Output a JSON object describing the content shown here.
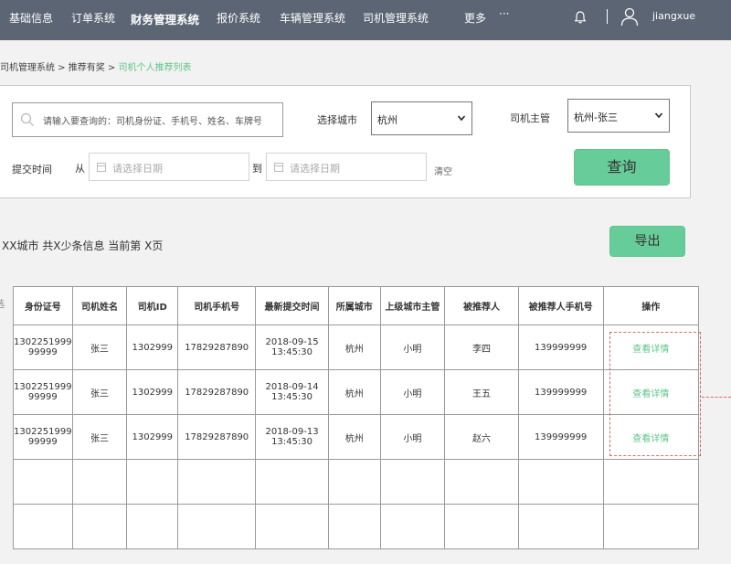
{
  "nav": {
    "items": [
      "基础信息",
      "订单系统",
      "财务管理系统",
      "报价系统",
      "车辆管理系统",
      "司机管理系统",
      "更多"
    ],
    "more_dots": "···",
    "username": "jiangxue"
  },
  "breadcrumb": {
    "part1": "司机管理系统",
    "sep1": " > ",
    "part2": "推荐有奖",
    "sep2": " > ",
    "current": "司机个人推荐列表"
  },
  "search": {
    "placeholder": "请输入要查询的：司机身份证、手机号、姓名、车牌号",
    "city_label": "选择城市",
    "city_value": "杭州",
    "manager_label": "司机主管",
    "manager_value": "杭州-张三",
    "time_label": "提交时间",
    "from_label": "从",
    "to_label": "到",
    "date_placeholder": "请选择日期",
    "clear_label": "清空",
    "query_label": "查询"
  },
  "summary": {
    "text": "XX城市 共X少条信息  当前第 X页",
    "export_label": "导出",
    "edge_char": "选"
  },
  "table": {
    "headers": [
      "身份证号",
      "司机姓名",
      "司机ID",
      "司机手机号",
      "最新提交时间",
      "所属城市",
      "上级城市主管",
      "被推荐人",
      "被推荐人手机号",
      "操作"
    ],
    "rows": [
      {
        "id_card_1": "1302251999",
        "id_card_2": "99999",
        "name": "张三",
        "driver_id": "1302999",
        "phone": "17829287890",
        "date": "2018-09-15",
        "time": "13:45:30",
        "city": "杭州",
        "manager": "小明",
        "referee": "李四",
        "referee_phone": "139999999",
        "action": "查看详情"
      },
      {
        "id_card_1": "1302251999",
        "id_card_2": "99999",
        "name": "张三",
        "driver_id": "1302999",
        "phone": "17829287890",
        "date": "2018-09-14",
        "time": "13:45:30",
        "city": "杭州",
        "manager": "小明",
        "referee": "王五",
        "referee_phone": "139999999",
        "action": "查看详情"
      },
      {
        "id_card_1": "1302251999",
        "id_card_2": "99999",
        "name": "张三",
        "driver_id": "1302999",
        "phone": "17829287890",
        "date": "2018-09-13",
        "time": "13:45:30",
        "city": "杭州",
        "manager": "小明",
        "referee": "赵六",
        "referee_phone": "139999999",
        "action": "查看详情"
      }
    ]
  },
  "colors": {
    "nav_bg": "#5b6573",
    "accent_green": "#66cc99",
    "link_green": "#5fc58a",
    "annotation_red": "#d06a6a"
  },
  "icons": [
    "bell-icon",
    "user-icon",
    "search-icon",
    "calendar-icon",
    "chevron-down-icon"
  ]
}
